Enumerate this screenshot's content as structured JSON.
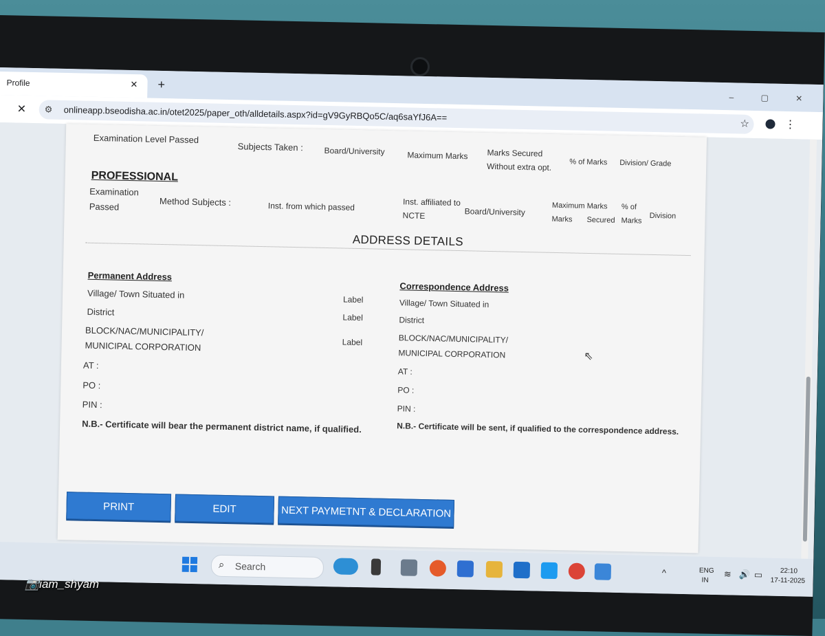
{
  "browser": {
    "tab_title": "Profile",
    "tab_close": "✕",
    "new_tab": "+",
    "stop_icon": "✕",
    "url": "onlineapp.bseodisha.ac.in/otet2025/paper_oth/alldetails.aspx?id=gV9GyRBQo5C/aq6saYfJ6A==",
    "window_controls": "‒ ▢ ✕"
  },
  "academic_headers": {
    "exam_level": "Examination Level Passed",
    "subjects": "Subjects Taken :",
    "board": "Board/University",
    "max_marks": "Maximum Marks",
    "marks_secured": "Marks Secured",
    "without_extra": "Without extra opt.",
    "percent": "% of Marks",
    "division": "Division/ Grade"
  },
  "professional": {
    "title": "PROFESSIONAL",
    "exam_line1": "Examination",
    "exam_line2": "Passed",
    "method": "Method Subjects :",
    "inst": "Inst. from which passed",
    "affil_line1": "Inst. affiliated to",
    "affil_line2": "NCTE",
    "board": "Board/University",
    "max_marks": "Maximum Marks",
    "marks": "Marks",
    "secured": "Secured",
    "pct_line1": "% of",
    "pct_line2": "Marks",
    "division": "Division"
  },
  "address": {
    "title": "ADDRESS DETAILS",
    "permanent": {
      "heading": "Permanent Address",
      "village": "Village/ Town Situated in",
      "district": "District",
      "block_line1": "BLOCK/NAC/MUNICIPALITY/",
      "block_line2": "MUNICIPAL CORPORATION",
      "at": "AT :",
      "po": "PO :",
      "pin": "PIN :",
      "note": "N.B.- Certificate will bear the permanent district name, if qualified.",
      "label1": "Label",
      "label2": "Label",
      "label3": "Label"
    },
    "correspondence": {
      "heading": "Correspondence Address",
      "village": "Village/ Town Situated in",
      "district": "District",
      "block_line1": "BLOCK/NAC/MUNICIPALITY/",
      "block_line2": "MUNICIPAL CORPORATION",
      "at": "AT :",
      "po": "PO :",
      "pin": "PIN :",
      "note": "N.B.- Certificate will be sent, if qualified to the correspondence address."
    }
  },
  "buttons": {
    "print": "PRINT",
    "edit": "EDIT",
    "next": "NEXT PAYMETNT & DECLARATION"
  },
  "taskbar": {
    "search_placeholder": "Search",
    "lang_line1": "ENG",
    "lang_line2": "IN",
    "time": "22:10",
    "date": "17-11-2025"
  },
  "watermark": "📷iam_shyam",
  "colors": {
    "button_blue": "#2f7ad1",
    "page_bg": "#f5f5f5"
  }
}
